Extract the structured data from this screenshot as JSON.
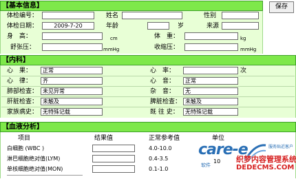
{
  "toolbar": {
    "save_label": "保存"
  },
  "basic": {
    "title": "【基本信息】",
    "exam_no_label": "体检编号：",
    "exam_no_value": "",
    "name_label": "姓名",
    "name_value": "",
    "sex_label": "性别",
    "sex_value": "",
    "exam_date_label": "体检日期：",
    "exam_date_value": "2009-7-20",
    "age_label": "年龄",
    "age_value": "",
    "age_unit": "岁",
    "source_label": "来源",
    "source_value": "",
    "height_label": "身　高：",
    "height_unit": "cm",
    "weight_label": "体　重：",
    "weight_unit": "kg",
    "diastolic_label": "舒张压：",
    "diastolic_unit": "mmHg",
    "systolic_label": "收缩压：",
    "systolic_unit": "mmHg"
  },
  "internal": {
    "title": "【内科】",
    "rows": [
      {
        "l_label": "心　果：",
        "l_value": "正常",
        "r_label": "心　率：",
        "r_value": "",
        "r_unit": "次"
      },
      {
        "l_label": "心　律：",
        "l_value": "齐",
        "r_label": "心　音：",
        "r_value": "正常",
        "r_unit": ""
      },
      {
        "l_label": "肺部检查：",
        "l_value": "未见异常",
        "r_label": "杂　音：",
        "r_value": "无",
        "r_unit": ""
      },
      {
        "l_label": "肝脏检查：",
        "l_value": "未触及",
        "r_label": "脾脏检查：",
        "r_value": "未触及",
        "r_unit": ""
      },
      {
        "l_label": "家族病史：",
        "l_value": "无特殊记载",
        "r_label": "既 往 史：",
        "r_value": "无特殊记载",
        "r_unit": ""
      }
    ]
  },
  "blood": {
    "title": "【血液分析】",
    "headers": {
      "item": "项目",
      "result": "结果值",
      "ref": "正常参考值",
      "unit": "单位"
    },
    "rows": [
      {
        "item": "白细胞 (WBC )",
        "ref": "4.0-10.0"
      },
      {
        "item": "淋巴细胞绝对值(LYM)",
        "ref": "0.4-3.5"
      },
      {
        "item": "单核细胞绝对值(MON)",
        "ref": "0.1-1.0"
      }
    ],
    "partial_unit": "10"
  },
  "watermark": {
    "logo": "care-e",
    "tagline1": "服务贴近客户",
    "tagline2": "软件",
    "site_cn": "织梦内容管理系统",
    "site_en": "DEDECMS.COM"
  },
  "colors": {
    "header_green": "#7ee84a",
    "panel_green": "#e8ffd6",
    "logo_blue": "#2a6fb5",
    "watermark_red": "#d62020"
  }
}
